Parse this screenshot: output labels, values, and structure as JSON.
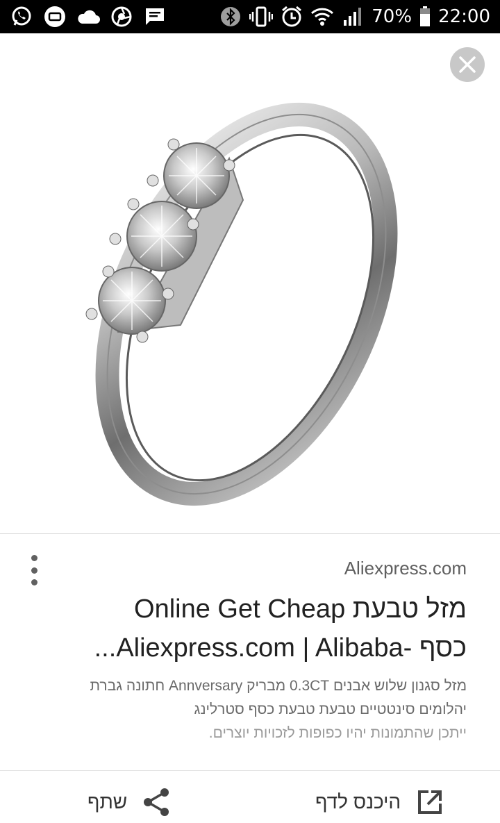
{
  "status_bar": {
    "battery": "70%",
    "time": "22:00",
    "icons_left": [
      "whatsapp-icon",
      "app-badge-icon",
      "cloud-icon",
      "aperture-icon",
      "message-icon"
    ],
    "icons_right": [
      "bluetooth-icon",
      "vibrate-icon",
      "alarm-icon",
      "wifi-icon",
      "signal-icon",
      "battery-icon"
    ]
  },
  "image_viewer": {
    "image": "silver-three-stone-ring",
    "close_icon": "close-icon"
  },
  "result": {
    "source": "Aliexpress.com",
    "title_line1": "מזל טבעת Online Get Cheap",
    "title_line2": "כסף -Aliexpress.com | Alibaba...",
    "snippet_line1": "מזל סגנון שלוש אבנים 0.3CT מבריק Annversary חתונה גברת",
    "snippet_line2": "יהלומים סינטטיים טבעת טבעת כסף סטרלינג",
    "snippet_line3": "ייתכן שהתמונות יהיו כפופות לזכויות יוצרים."
  },
  "actions": {
    "visit_label": "היכנס לדף",
    "share_label": "שתף"
  },
  "colors": {
    "status_bar": "#000000",
    "close_bg": "#c8c8c8",
    "title": "#212121",
    "snippet": "#6a6a6a"
  }
}
